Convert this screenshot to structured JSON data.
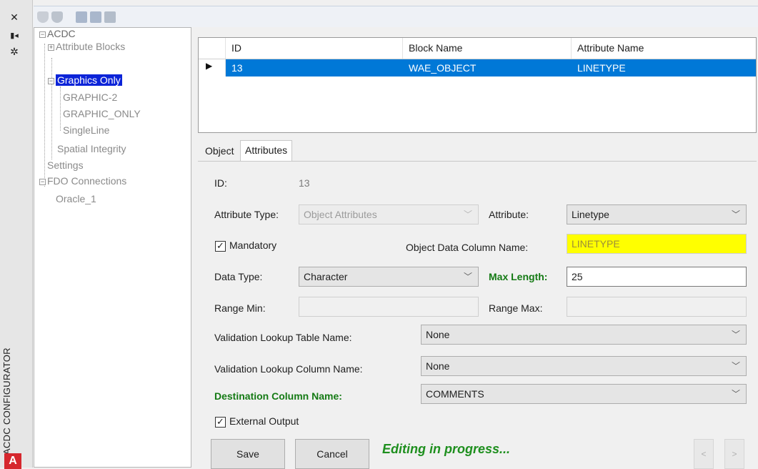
{
  "side_strip": {
    "title": "ACDC CONFIGURATOR",
    "icons": [
      "close-icon",
      "pin-icon",
      "settings-icon"
    ],
    "logo_letter": "A"
  },
  "toolbar": {
    "icons": [
      "shield-icon",
      "shield-add-icon",
      "grid-icon",
      "grid-edit-icon",
      "grid-settings-icon"
    ]
  },
  "tree": {
    "items": [
      {
        "label": "ACDC",
        "expander": "−"
      },
      {
        "label": "Attribute Blocks",
        "expander": "+"
      },
      {
        "label": "Graphics Only",
        "expander": "−"
      },
      {
        "label": "GRAPHIC-2"
      },
      {
        "label": "GRAPHIC_ONLY"
      },
      {
        "label": "SingleLine"
      },
      {
        "label": "Spatial Integrity"
      },
      {
        "label": "Settings"
      },
      {
        "label": "FDO Connections",
        "expander": "−"
      },
      {
        "label": "Oracle_1"
      }
    ]
  },
  "grid": {
    "columns": [
      "ID",
      "Block Name",
      "Attribute Name"
    ],
    "rows": [
      {
        "id": "13",
        "block_name": "WAE_OBJECT",
        "attribute_name": "LINETYPE"
      }
    ],
    "selection_color": "#0078d7"
  },
  "tabs": [
    "Object",
    "Attributes"
  ],
  "form": {
    "id_label": "ID:",
    "id_value": "13",
    "attribute_type_label": "Attribute Type:",
    "attribute_type_value": "Object Attributes",
    "attribute_label": "Attribute:",
    "attribute_value": "Linetype",
    "mandatory_label": "Mandatory",
    "mandatory_checked": "✓",
    "od_column_label": "Object Data Column Name:",
    "od_column_value": "LINETYPE",
    "data_type_label": "Data Type:",
    "data_type_value": "Character",
    "max_length_label": "Max Length:",
    "max_length_value": "25",
    "range_min_label": "Range Min:",
    "range_min_value": "",
    "range_max_label": "Range Max:",
    "range_max_value": "",
    "val_table_label": "Validation Lookup Table Name:",
    "val_table_value": "None",
    "val_column_label": "Validation Lookup Column Name:",
    "val_column_value": "None",
    "dest_column_label": "Destination Column Name:",
    "dest_column_value": "COMMENTS",
    "external_output_label": "External Output",
    "external_output_checked": "✓"
  },
  "actions": {
    "save_label": "Save",
    "cancel_label": "Cancel",
    "status_text": "Editing in progress...",
    "prev_label": "<",
    "next_label": ">"
  },
  "colors": {
    "highlight_yellow": "#ffff00",
    "label_green": "#147a14",
    "status_green": "#1e8f1e",
    "tree_select": "#0c24d8"
  }
}
